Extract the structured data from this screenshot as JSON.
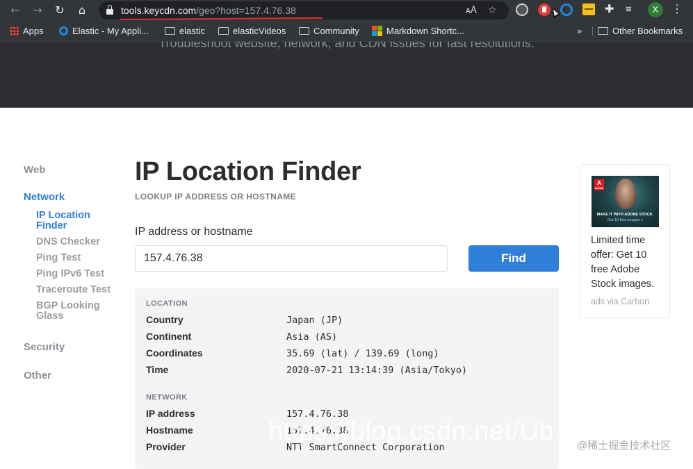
{
  "browser": {
    "url_host": "tools.keycdn.com",
    "url_path": "/geo?host=157.4.76.38",
    "profile_initial": "X",
    "bookmarks": [
      {
        "label": "Apps",
        "icon": "apps-grid-icon"
      },
      {
        "label": "Elastic - My Appli...",
        "icon": "elastic-icon"
      },
      {
        "label": "elastic",
        "icon": "folder-icon"
      },
      {
        "label": "elasticVideos",
        "icon": "folder-icon"
      },
      {
        "label": "Community",
        "icon": "folder-icon"
      },
      {
        "label": "Markdown Shortc...",
        "icon": "microsoft-icon"
      }
    ],
    "overflow_label": "»",
    "other_bookmarks": "Other Bookmarks",
    "ms_colors": [
      "#f25022",
      "#7fba00",
      "#00a4ef",
      "#ffb900"
    ]
  },
  "hero": {
    "tagline": "Troubleshoot website, network, and CDN issues for fast resolutions."
  },
  "sidebar": {
    "web": "Web",
    "network": "Network",
    "network_items": [
      "IP Location Finder",
      "DNS Checker",
      "Ping Test",
      "Ping IPv6 Test",
      "Traceroute Test",
      "BGP Looking Glass"
    ],
    "security": "Security",
    "other": "Other"
  },
  "main": {
    "title": "IP Location Finder",
    "subtitle": "LOOKUP IP ADDRESS OR HOSTNAME",
    "field_label": "IP address or hostname",
    "input_value": "157.4.76.38",
    "find_label": "Find"
  },
  "results": {
    "location_title": "LOCATION",
    "location": [
      {
        "key": "Country",
        "value": "Japan (JP)"
      },
      {
        "key": "Continent",
        "value": "Asia (AS)"
      },
      {
        "key": "Coordinates",
        "value": "35.69 (lat) / 139.69 (long)"
      },
      {
        "key": "Time",
        "value": "2020-07-21 13:14:39 (Asia/Tokyo)"
      }
    ],
    "network_title": "NETWORK",
    "network": [
      {
        "key": "IP address",
        "value": "157.4.76.38"
      },
      {
        "key": "Hostname",
        "value": "157.4.76.38"
      },
      {
        "key": "Provider",
        "value": "NTT SmartConnect Corporation"
      }
    ]
  },
  "ad": {
    "logo": "A",
    "logo_sub": "Adobe",
    "headline": "MAKE IT WITH ADOBE STOCK.",
    "cta": "Get 10 free images >",
    "text": "Limited time offer: Get 10 free Adobe Stock images.",
    "via": "ads via Carbon"
  },
  "overlay": {
    "watermark": "https://blog.csdn.net/Ub",
    "badge": "@稀土掘金技术社区"
  }
}
